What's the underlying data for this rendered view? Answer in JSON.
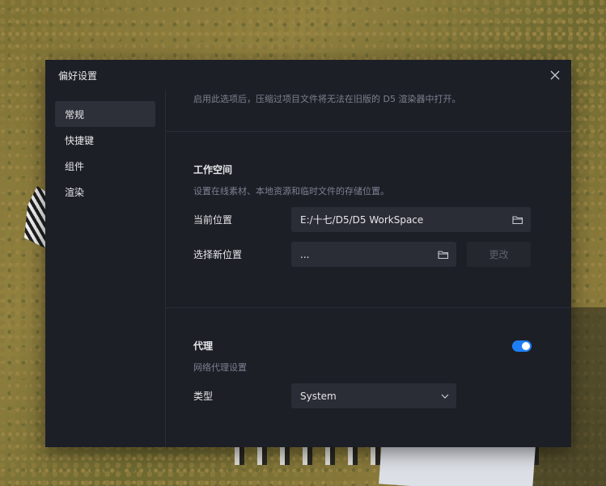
{
  "dialog": {
    "title": "偏好设置"
  },
  "sidebar": {
    "items": [
      {
        "label": "常规",
        "active": true
      },
      {
        "label": "快捷键",
        "active": false
      },
      {
        "label": "组件",
        "active": false
      },
      {
        "label": "渲染",
        "active": false
      }
    ]
  },
  "top_section": {
    "description": "启用此选项后，压缩过项目文件将无法在旧版的 D5 渲染器中打开。"
  },
  "workspace": {
    "heading": "工作空间",
    "description": "设置在线素材、本地资源和临时文件的存储位置。",
    "current_label": "当前位置",
    "current_value": "E:/十七/D5/D5 WorkSpace",
    "new_label": "选择新位置",
    "new_value": "...",
    "change_button": "更改"
  },
  "proxy": {
    "heading": "代理",
    "description": "网络代理设置",
    "enabled": true,
    "type_label": "类型",
    "type_value": "System"
  },
  "colors": {
    "accent": "#1e7ef7",
    "panel": "#1c1f26",
    "field": "#2a2d35"
  },
  "icons": {
    "close": "close-icon",
    "folder": "folder-icon",
    "chevron": "chevron-down-icon"
  }
}
